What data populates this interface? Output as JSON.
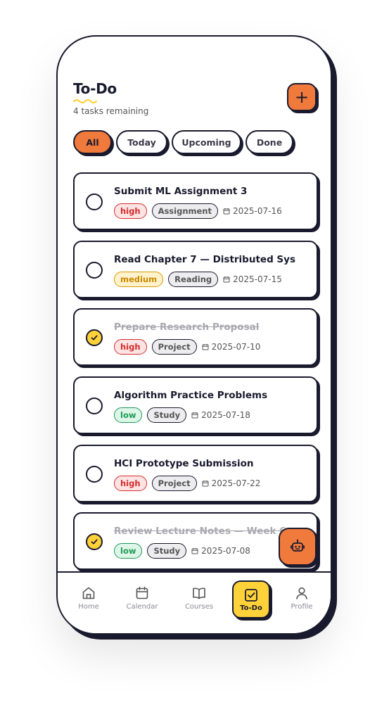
{
  "header": {
    "title": "To-Do",
    "subtitle": "4 tasks remaining",
    "add_icon": "plus-icon"
  },
  "filters": [
    {
      "label": "All",
      "active": true
    },
    {
      "label": "Today",
      "active": false
    },
    {
      "label": "Upcoming",
      "active": false
    },
    {
      "label": "Done",
      "active": false
    }
  ],
  "tasks": [
    {
      "title": "Submit ML Assignment 3",
      "priority": "high",
      "category": "Assignment",
      "date": "2025-07-16",
      "done": false
    },
    {
      "title": "Read Chapter 7 — Distributed Sys",
      "priority": "medium",
      "category": "Reading",
      "date": "2025-07-15",
      "done": false
    },
    {
      "title": "Prepare Research Proposal",
      "priority": "high",
      "category": "Project",
      "date": "2025-07-10",
      "done": true
    },
    {
      "title": "Algorithm Practice Problems",
      "priority": "low",
      "category": "Study",
      "date": "2025-07-18",
      "done": false
    },
    {
      "title": "HCI Prototype Submission",
      "priority": "high",
      "category": "Project",
      "date": "2025-07-22",
      "done": false
    },
    {
      "title": "Review Lecture Notes — Week 6",
      "priority": "low",
      "category": "Study",
      "date": "2025-07-08",
      "done": true
    }
  ],
  "assistant_icon": "robot-icon",
  "nav": [
    {
      "label": "Home",
      "icon": "home-icon",
      "active": false
    },
    {
      "label": "Calendar",
      "icon": "calendar-icon",
      "active": false
    },
    {
      "label": "Courses",
      "icon": "book-icon",
      "active": false
    },
    {
      "label": "To-Do",
      "icon": "checkbox-icon",
      "active": true
    },
    {
      "label": "Profile",
      "icon": "user-icon",
      "active": false
    }
  ],
  "colors": {
    "accent": "#f07a3c",
    "highlight": "#ffd23a",
    "ink": "#1a1a2e"
  }
}
